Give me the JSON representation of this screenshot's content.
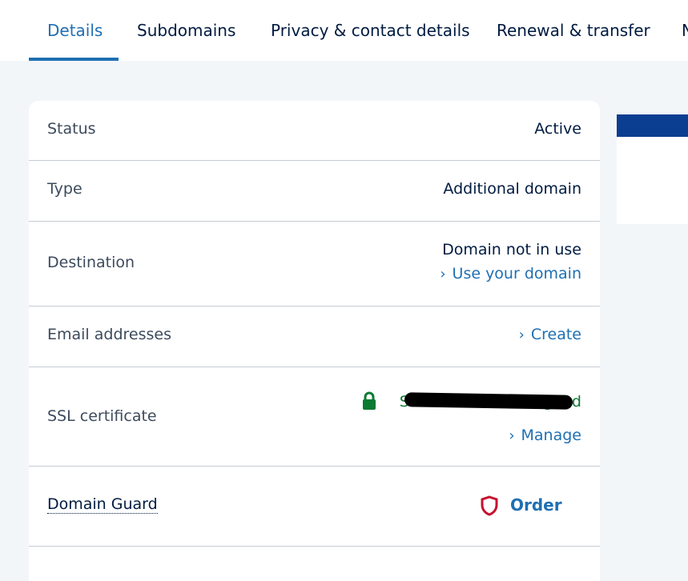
{
  "tabs": [
    {
      "label": "Details",
      "active": true
    },
    {
      "label": "Subdomains"
    },
    {
      "label": "Privacy & contact details"
    },
    {
      "label": "Renewal & transfer"
    },
    {
      "label": "N"
    }
  ],
  "details": {
    "status": {
      "label": "Status",
      "value": "Active"
    },
    "type": {
      "label": "Type",
      "value": "Additional domain"
    },
    "destination": {
      "label": "Destination",
      "value": "Domain not in use",
      "action": "Use your domain"
    },
    "email": {
      "label": "Email addresses",
      "action": "Create"
    },
    "ssl": {
      "label": "SSL certificate",
      "status": "SSL certificate assigned",
      "action": "Manage"
    },
    "domain_guard": {
      "label": "Domain Guard",
      "action": "Order"
    }
  },
  "icons": {
    "chevron": "chevron-right-icon",
    "lock": "lock-icon",
    "shield": "shield-icon"
  },
  "colors": {
    "accent": "#1f6fb3",
    "text": "#001b41",
    "ssl_green": "#0b7a33",
    "shield_red": "#c8102e",
    "background": "#f3f6f9"
  }
}
